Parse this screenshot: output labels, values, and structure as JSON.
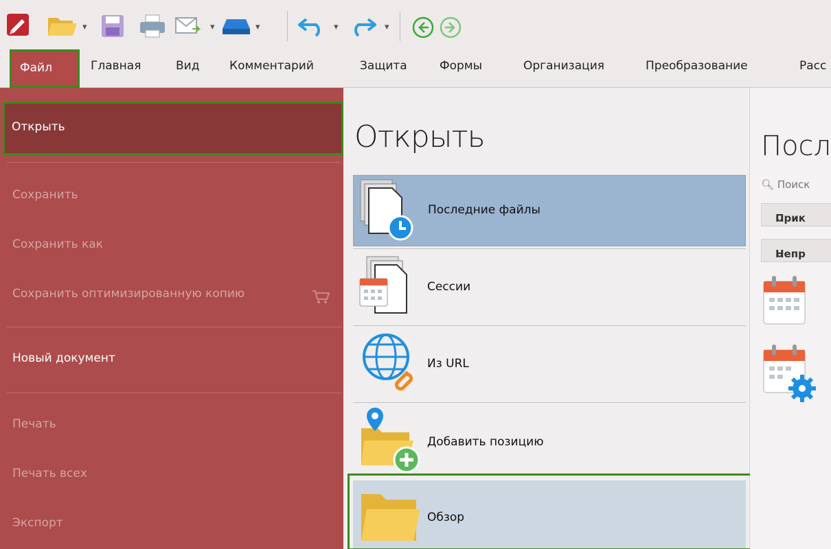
{
  "toolbar": {
    "icons": [
      "app-logo-icon",
      "open-folder-icon",
      "save-icon",
      "print-icon",
      "email-icon",
      "scan-icon",
      "undo-icon",
      "redo-icon",
      "back-icon",
      "forward-icon"
    ]
  },
  "ribbon": {
    "tabs": [
      "Файл",
      "Главная",
      "Вид",
      "Комментарий",
      "Защита",
      "Формы",
      "Организация",
      "Преобразование",
      "Расс"
    ],
    "active_tab": "Файл"
  },
  "backstage": {
    "nav": [
      {
        "label": "Открыть",
        "state": "selected"
      },
      {
        "label": "Сохранить",
        "state": "disabled"
      },
      {
        "label": "Сохранить как",
        "state": "disabled"
      },
      {
        "label": "Сохранить оптимизированную копию",
        "state": "disabled"
      },
      {
        "label": "Новый документ",
        "state": "enabled"
      },
      {
        "label": "Печать",
        "state": "disabled"
      },
      {
        "label": "Печать всех",
        "state": "disabled"
      },
      {
        "label": "Экспорт",
        "state": "disabled"
      }
    ]
  },
  "open_panel": {
    "title": "Открыть",
    "options": [
      {
        "label": "Последние файлы",
        "icon": "recent-files-icon",
        "state": "selected"
      },
      {
        "label": "Сессии",
        "icon": "sessions-icon",
        "state": "normal"
      },
      {
        "label": "Из URL",
        "icon": "url-globe-icon",
        "state": "normal"
      },
      {
        "label": "Добавить позицию",
        "icon": "add-place-icon",
        "state": "normal"
      },
      {
        "label": "Обзор",
        "icon": "browse-folder-icon",
        "state": "hover"
      }
    ]
  },
  "recent_panel": {
    "title": "Посл",
    "search_placeholder": "Поиск",
    "groups": [
      "Прик",
      "Непр"
    ]
  },
  "colors": {
    "nav_bg": "#ad4c4c",
    "nav_selected": "#893838",
    "highlight_outline": "#3c8a1c",
    "option_selected": "#9bb4d0"
  }
}
